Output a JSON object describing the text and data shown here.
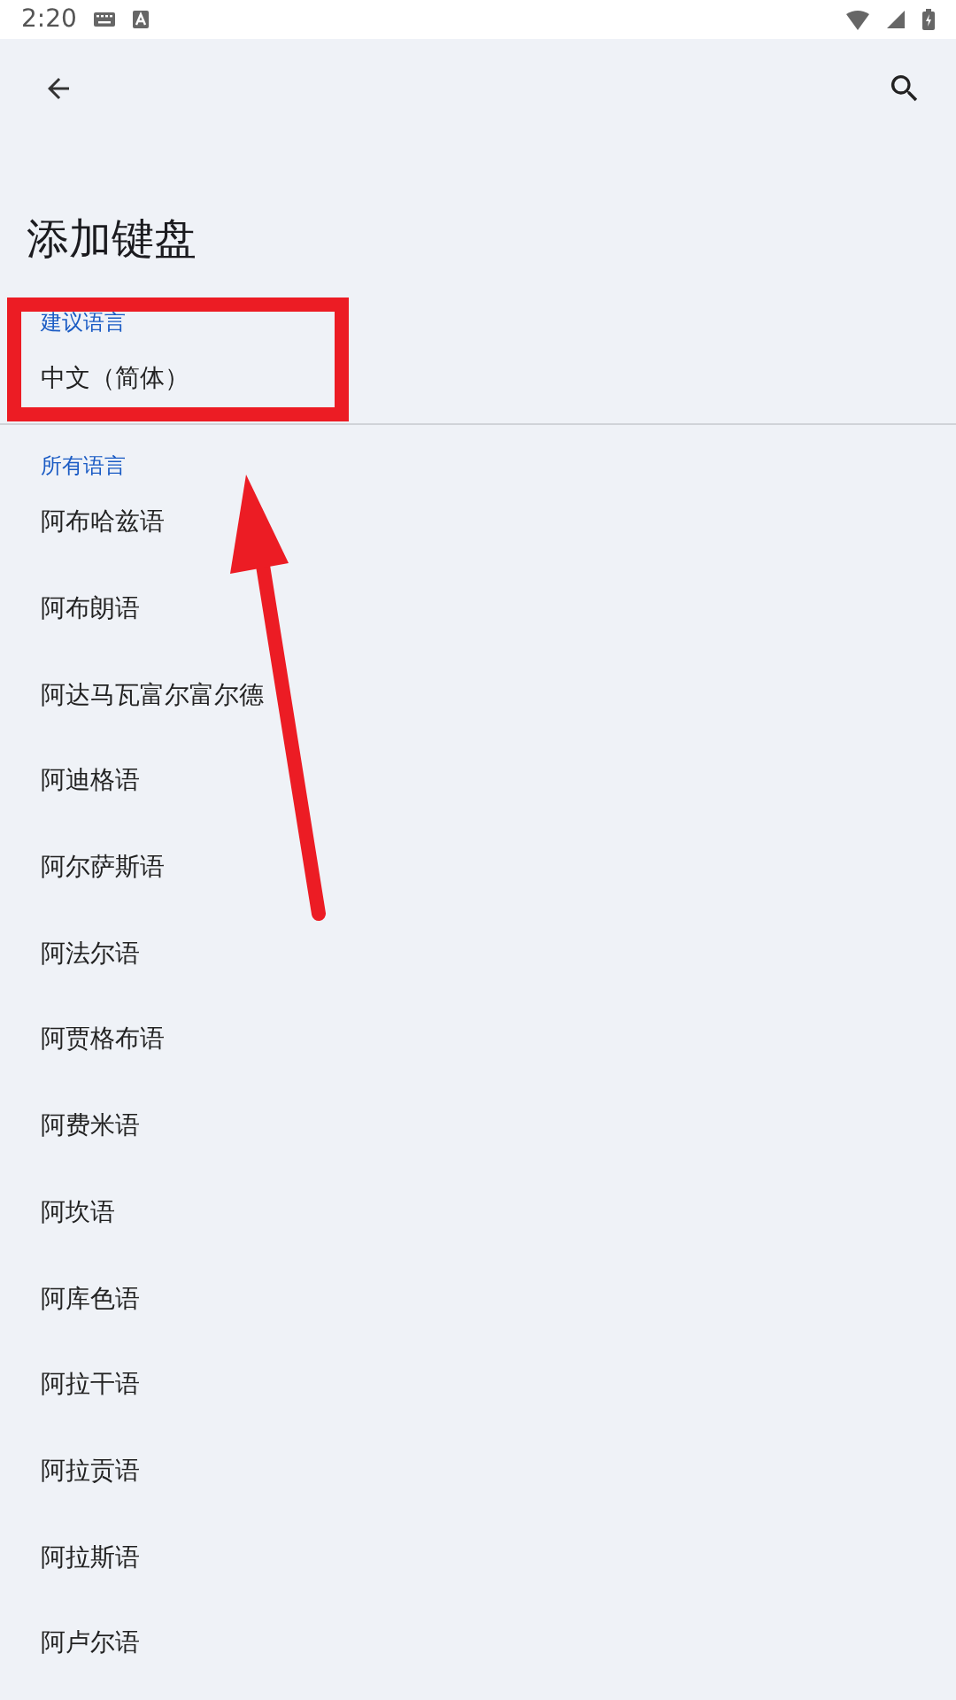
{
  "status_bar": {
    "time": "2:20"
  },
  "title": "添加键盘",
  "suggested": {
    "header": "建议语言",
    "items": [
      "中文（简体）"
    ]
  },
  "all": {
    "header": "所有语言",
    "items": [
      "阿布哈兹语",
      "阿布朗语",
      "阿达马瓦富尔富尔德",
      "阿迪格语",
      "阿尔萨斯语",
      "阿法尔语",
      "阿贾格布语",
      "阿费米语",
      "阿坎语",
      "阿库色语",
      "阿拉干语",
      "阿拉贡语",
      "阿拉斯语",
      "阿卢尔语"
    ]
  }
}
